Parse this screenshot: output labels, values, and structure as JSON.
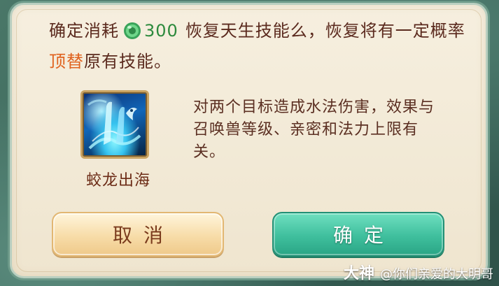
{
  "dialog": {
    "message": {
      "prefix": "确定消耗",
      "cost": "300",
      "middle": "恢复天生技能么，恢复将有一定概率",
      "highlight": "顶替",
      "suffix": "原有技能。"
    },
    "currency_icon": "jade-coin-icon",
    "skill": {
      "icon": "water-dragon-skill-icon",
      "name": "蛟龙出海",
      "description": "对两个目标造成水法伤害，效果与召唤兽等级、亲密和法力上限有关。"
    },
    "buttons": {
      "cancel_label": "取消",
      "confirm_label": "确定"
    }
  },
  "watermark": {
    "logo": "大神",
    "text": "@你们亲爱的大明哥"
  },
  "colors": {
    "message_text": "#5b2a1e",
    "cost_green": "#2d8a3d",
    "highlight_orange": "#e0621e",
    "confirm_button": "#3fbf9d",
    "cancel_button": "#f7dca8"
  }
}
